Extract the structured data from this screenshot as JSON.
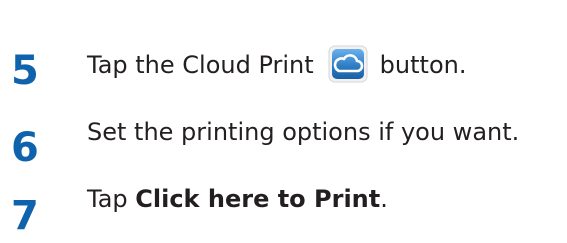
{
  "steps": [
    {
      "number": "5",
      "text_before": "Tap the Cloud Print",
      "icon": "cloud-print-icon",
      "text_after": "button."
    },
    {
      "number": "6",
      "text": "Set the printing options if you want."
    },
    {
      "number": "7",
      "text_before": "Tap ",
      "bold": "Click here to Print",
      "text_after": "."
    }
  ],
  "colors": {
    "step_number": "#0f63ad",
    "body_text": "#231f20",
    "icon_blue": "#2f7fc6"
  }
}
